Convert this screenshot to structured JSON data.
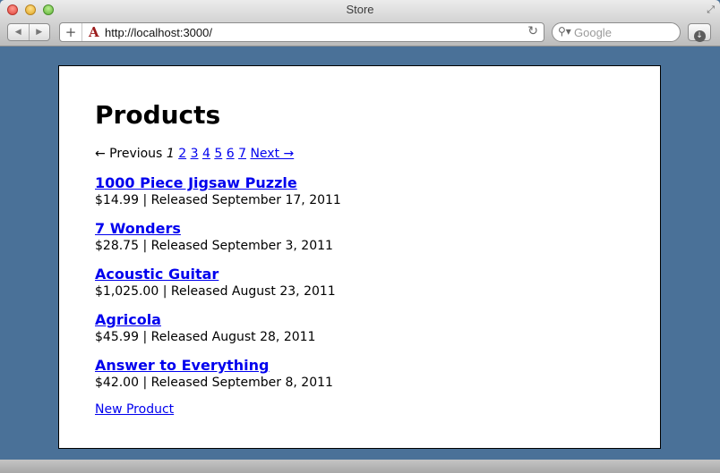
{
  "window": {
    "title": "Store"
  },
  "toolbar": {
    "url": "http://localhost:3000/",
    "search_placeholder": "Google"
  },
  "page": {
    "heading": "Products",
    "pagination": {
      "previous": "← Previous",
      "current": "1",
      "pages": [
        "2",
        "3",
        "4",
        "5",
        "6",
        "7"
      ],
      "next": "Next →"
    },
    "products": [
      {
        "name": "1000 Piece Jigsaw Puzzle",
        "price": "$14.99",
        "released": "Released September 17, 2011"
      },
      {
        "name": "7 Wonders",
        "price": "$28.75",
        "released": "Released September 3, 2011"
      },
      {
        "name": "Acoustic Guitar",
        "price": "$1,025.00",
        "released": "Released August 23, 2011"
      },
      {
        "name": "Agricola",
        "price": "$45.99",
        "released": "Released August 28, 2011"
      },
      {
        "name": "Answer to Everything",
        "price": "$42.00",
        "released": "Released September 8, 2011"
      }
    ],
    "separator": "|",
    "new_product_link": "New Product"
  },
  "colors": {
    "desktop_background": "#4a7198",
    "link": "#0000ee",
    "favicon": "#9c1c1c"
  },
  "icons": {
    "back": "back-arrow-icon",
    "forward": "forward-arrow-icon",
    "add_tab": "plus-icon",
    "favicon": "rails-favicon-icon",
    "reload": "reload-icon",
    "search": "magnifier-icon",
    "download": "download-icon",
    "fullscreen": "fullscreen-icon"
  }
}
